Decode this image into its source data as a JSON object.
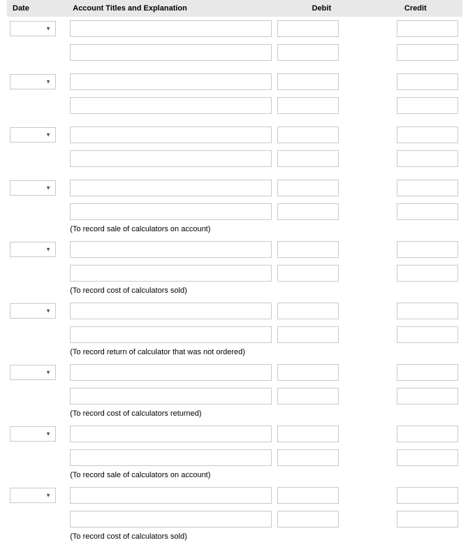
{
  "headers": {
    "date": "Date",
    "account": "Account Titles and Explanation",
    "debit": "Debit",
    "credit": "Credit"
  },
  "entries": [
    {
      "date": "",
      "line1": {
        "account": "",
        "debit": "",
        "credit": ""
      },
      "line2": {
        "account": "",
        "debit": "",
        "credit": ""
      },
      "explanation": null
    },
    {
      "date": "",
      "line1": {
        "account": "",
        "debit": "",
        "credit": ""
      },
      "line2": {
        "account": "",
        "debit": "",
        "credit": ""
      },
      "explanation": null
    },
    {
      "date": "",
      "line1": {
        "account": "",
        "debit": "",
        "credit": ""
      },
      "line2": {
        "account": "",
        "debit": "",
        "credit": ""
      },
      "explanation": null
    },
    {
      "date": "",
      "line1": {
        "account": "",
        "debit": "",
        "credit": ""
      },
      "line2": {
        "account": "",
        "debit": "",
        "credit": ""
      },
      "explanation": "(To record sale of calculators on account)"
    },
    {
      "date": "",
      "line1": {
        "account": "",
        "debit": "",
        "credit": ""
      },
      "line2": {
        "account": "",
        "debit": "",
        "credit": ""
      },
      "explanation": "(To record cost of calculators sold)"
    },
    {
      "date": "",
      "line1": {
        "account": "",
        "debit": "",
        "credit": ""
      },
      "line2": {
        "account": "",
        "debit": "",
        "credit": ""
      },
      "explanation": "(To record return of calculator that was not ordered)"
    },
    {
      "date": "",
      "line1": {
        "account": "",
        "debit": "",
        "credit": ""
      },
      "line2": {
        "account": "",
        "debit": "",
        "credit": ""
      },
      "explanation": "(To record cost of calculators returned)"
    },
    {
      "date": "",
      "line1": {
        "account": "",
        "debit": "",
        "credit": ""
      },
      "line2": {
        "account": "",
        "debit": "",
        "credit": ""
      },
      "explanation": "(To record sale of calculators on account)"
    },
    {
      "date": "",
      "line1": {
        "account": "",
        "debit": "",
        "credit": ""
      },
      "line2": {
        "account": "",
        "debit": "",
        "credit": ""
      },
      "explanation": "(To record cost of calculators sold)"
    }
  ]
}
